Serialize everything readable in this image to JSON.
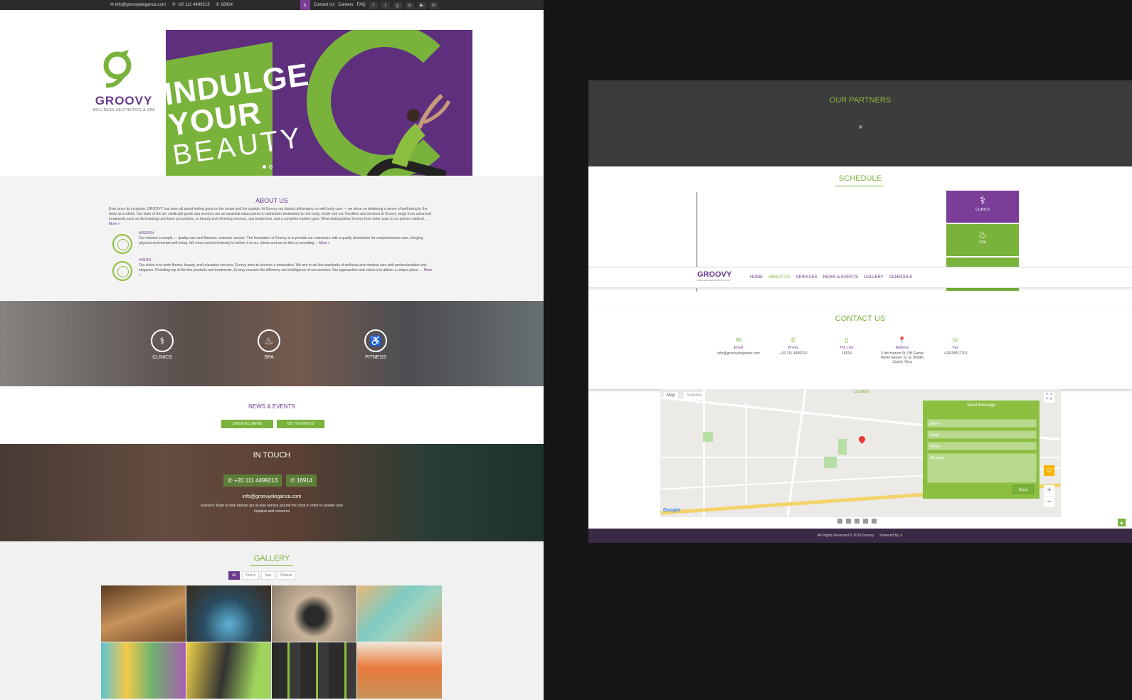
{
  "topbar": {
    "email": "info@groovyeleganza.com",
    "phone": "+20 111 4499213",
    "hotline": "16914",
    "lang": "ع",
    "contact": "Contact Us",
    "careers": "Careers",
    "faq": "FAQ"
  },
  "hero": {
    "line1": "INDULGE",
    "line2": "YOUR",
    "line3": "BEAUTY",
    "brand": "GROOVY",
    "tagline": "WELLNESS AESTHETICS & SPA"
  },
  "about": {
    "title": "ABOUT US",
    "intro": "Ever since its inception, GROOVY has been all about feeling good on the inside and the outside. At Groovy our distinct philosophy on well-body care — we strive on delivering a sense of well-being to the body as a whole. Our state of the art, medically-grade spa services are an essential value paired to administer treatments for the body, inside and out. Facilities and services at Groovy range from advanced treatments such as dermatology and laser procedures, to beauty and slimming services, spa treatments, and a complete modern gym. What distinguishes Groovy from other spas is our proven medical ...",
    "intro_more": "More »",
    "mission_title": "MISSION",
    "mission_text": "Our mission is simple — quality care and flawless customer service. The foundation of Groovy is to provide our customers with a quality destination for comprehensive care, bringing physical and mental well-being. We have worked tirelessly to deliver it to our clients and we do this by providing ...",
    "mission_more": "More »",
    "vision_title": "VISION",
    "vision_text": "Our vision is to unite fitness, beauty, and relaxation services. Groovy aims to become a destination. We aim to set the standards of wellness and medical care with professionalism and elegance. Providing top of the line products and treatments, Groovy ensures the efficiency and intelligence of our services. Our approaches and vision is to deliver a unique place. ...",
    "vision_more": "More »"
  },
  "services": [
    {
      "label": "CLINICS",
      "icon": "stethoscope-icon"
    },
    {
      "label": "SPA",
      "icon": "massage-icon"
    },
    {
      "label": "FITNESS",
      "icon": "fitness-icon"
    }
  ],
  "news": {
    "title": "NEWS & EVENTS",
    "btn_news": "SHOW ALL NEWS",
    "btn_events": "GO TO EVENTS"
  },
  "touch": {
    "title": "IN TOUCH",
    "phone": "+20 111 4499213",
    "hotline": "16914",
    "email": "info@groovyeleganza.com",
    "desc": "Groovy's Team is here and we are at your service around the clock in order to answer your inquiries and concerns"
  },
  "gallery": {
    "title": "GALLERY",
    "filters": [
      "All",
      "Clinics",
      "Spa",
      "Fitness"
    ]
  },
  "partners": {
    "title": "OUR PARTNERS"
  },
  "schedule": {
    "title": "SCHEDULE",
    "boxes": [
      "CLINICS",
      "SPA",
      ""
    ]
  },
  "nav": {
    "brand": "GROOVY",
    "tagline": "WELLNESS AESTHETICS & SPA",
    "items": [
      "HOME",
      "ABOUT US",
      "SERVICES",
      "NEWS & EVENTS",
      "GALLERY",
      "SCHEDULE"
    ]
  },
  "contact": {
    "title": "CONTACT US",
    "items": [
      {
        "label": "Email",
        "value": "info@groovyeleganza.com",
        "icon": "envelope-icon"
      },
      {
        "label": "Phone",
        "value": "+20 111 4499213",
        "icon": "phone-icon"
      },
      {
        "label": "Hot Line",
        "value": "16914",
        "icon": "mobile-icon"
      },
      {
        "label": "Address",
        "value": "3 Ibn Hazem St. Off Gamal Abdel Nasser St. El Sheikh Zayed, Giza",
        "icon": "pin-icon"
      },
      {
        "label": "Fax",
        "value": "+20238517761",
        "icon": "fax-icon"
      }
    ]
  },
  "map": {
    "tab_map": "Map",
    "tab_sat": "Satellite",
    "location": "Location",
    "form_title": "Send Message",
    "name_ph": "Name",
    "email_ph": "Email",
    "mobile_ph": "Mobile",
    "message_ph": "Message",
    "send": "Send",
    "google": "Google"
  },
  "footer": {
    "rights": "All Rights Reserved © 2016 Groovy",
    "powered": "Powered By"
  },
  "colors": {
    "purple": "#6b3a8c",
    "green": "#7ab33c",
    "dark": "#2b2b2b"
  }
}
